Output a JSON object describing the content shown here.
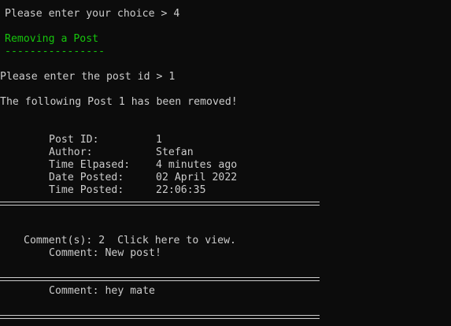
{
  "console": {
    "prompt_choice": "Please enter your choice > 4",
    "section_title": "Removing a Post",
    "section_underline": "----------------",
    "prompt_post_id": "Please enter the post id > 1",
    "removed_message": "The following Post 1 has been removed!",
    "post": {
      "fields": [
        {
          "label": "Post ID:",
          "value": "1"
        },
        {
          "label": "Author:",
          "value": "Stefan"
        },
        {
          "label": "Time Elpased:",
          "value": "4 minutes ago"
        },
        {
          "label": "Date Posted:",
          "value": "02 April 2022"
        },
        {
          "label": "Time Posted:",
          "value": "22:06:35"
        }
      ]
    },
    "comments_header": "Comment(s): 2  Click here to view.",
    "comments": [
      {
        "text": "Comment: New post!"
      },
      {
        "text": "Comment: hey mate"
      }
    ]
  },
  "colors": {
    "background": "#0c0c0c",
    "text": "#cccccc",
    "heading": "#16c60c"
  }
}
